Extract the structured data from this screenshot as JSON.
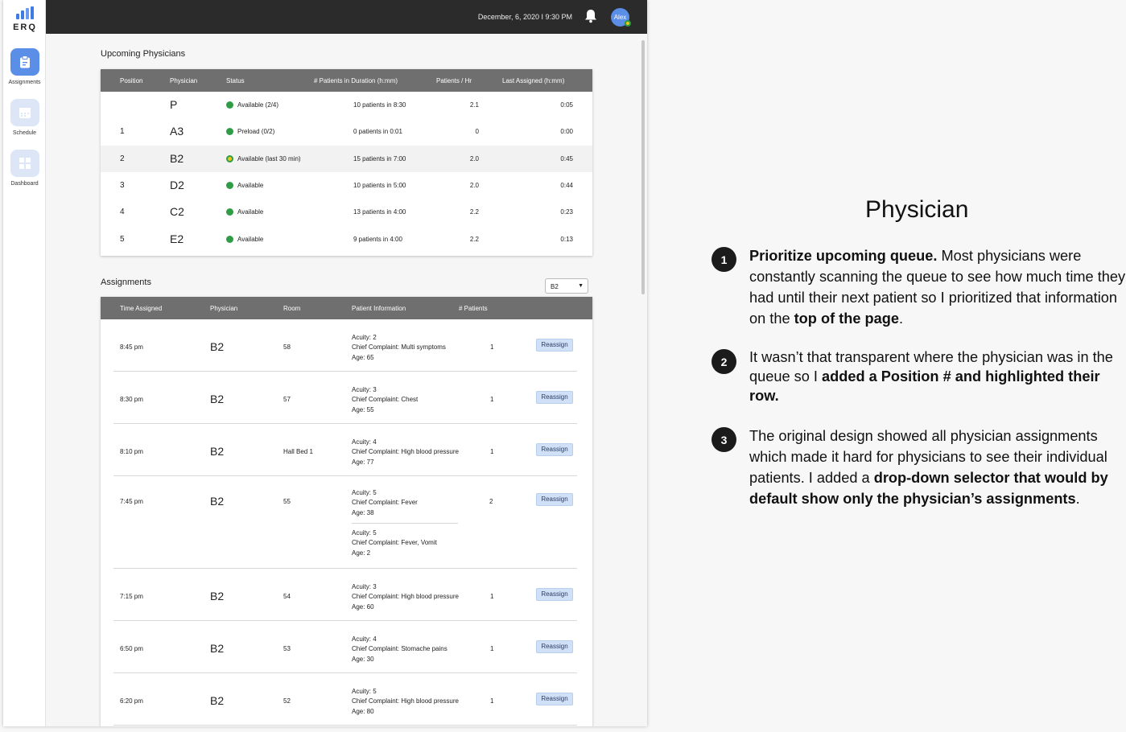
{
  "sidebar": {
    "logo_text": "ERQ",
    "items": [
      {
        "label": "Assignments",
        "active": true
      },
      {
        "label": "Schedule",
        "active": false
      },
      {
        "label": "Dashboard",
        "active": false
      }
    ]
  },
  "topbar": {
    "datetime": "December, 6, 2020  I  9:30 PM",
    "avatar_name": "Alex"
  },
  "upcoming": {
    "title": "Upcoming Physicians",
    "headers": [
      "Position",
      "Physician",
      "Status",
      "# Patients in Duration (h:mm)",
      "Patients / Hr",
      "Last Assigned (h:mm)"
    ],
    "rows": [
      {
        "position": "",
        "physician": "P",
        "status": "Available (2/4)",
        "duration": "10 patients in 8:30",
        "per_hr": "2.1",
        "last": "0:05"
      },
      {
        "position": "1",
        "physician": "A3",
        "status": "Preload (0/2)",
        "duration": "0 patients in 0:01",
        "per_hr": "0",
        "last": "0:00"
      },
      {
        "position": "2",
        "physician": "B2",
        "status": "Available (last 30 min)",
        "duration": "15 patients in 7:00",
        "per_hr": "2.0",
        "last": "0:45"
      },
      {
        "position": "3",
        "physician": "D2",
        "status": "Available",
        "duration": "10 patients in 5:00",
        "per_hr": "2.0",
        "last": "0:44"
      },
      {
        "position": "4",
        "physician": "C2",
        "status": "Available",
        "duration": "13 patients in 4:00",
        "per_hr": "2.2",
        "last": "0:23"
      },
      {
        "position": "5",
        "physician": "E2",
        "status": "Available",
        "duration": "9 patients in 4:00",
        "per_hr": "2.2",
        "last": "0:13"
      }
    ]
  },
  "assignments": {
    "title": "Assignments",
    "filter_value": "B2",
    "headers": [
      "Time Assigned",
      "Physician",
      "Room",
      "Patient Information",
      "# Patients"
    ],
    "action_label": "Reassign",
    "rows": [
      {
        "time": "8:45 pm",
        "physician": "B2",
        "room": "58",
        "acuity": "Acuity: 2",
        "complaint": "Chief Complaint: Multi symptoms",
        "age": "Age: 65",
        "count": "1"
      },
      {
        "time": "8:30 pm",
        "physician": "B2",
        "room": "57",
        "acuity": "Acuity: 3",
        "complaint": "Chief Complaint: Chest",
        "age": "Age: 55",
        "count": "1"
      },
      {
        "time": "8:10 pm",
        "physician": "B2",
        "room": "Hall Bed 1",
        "acuity": "Acuity: 4",
        "complaint": "Chief Complaint: High blood pressure",
        "age": "Age: 77",
        "count": "1"
      },
      {
        "time": "7:45 pm",
        "physician": "B2",
        "room": "55",
        "acuity": "Acuity: 5",
        "complaint": "Chief Complaint: Fever",
        "age": "Age: 38",
        "count": "2",
        "acuity2": "Acuity: 5",
        "complaint2": "Chief Complaint: Fever, Vomit",
        "age2": "Age: 2"
      },
      {
        "time": "7:15 pm",
        "physician": "B2",
        "room": "54",
        "acuity": "Acuity: 3",
        "complaint": "Chief Complaint: High blood pressure",
        "age": "Age: 60",
        "count": "1"
      },
      {
        "time": "6:50 pm",
        "physician": "B2",
        "room": "53",
        "acuity": "Acuity: 4",
        "complaint": "Chief Complaint: Stomache pains",
        "age": "Age: 30",
        "count": "1"
      },
      {
        "time": "6:20 pm",
        "physician": "B2",
        "room": "52",
        "acuity": "Acuity: 5",
        "complaint": "Chief Complaint: High blood pressure",
        "age": "Age: 80",
        "count": "1"
      }
    ]
  },
  "panel": {
    "title": "Physician",
    "notes": [
      {
        "number": "1",
        "parts": [
          {
            "text": "Prioritize upcoming queue.",
            "bold": true
          },
          {
            "text": " Most physicians were constantly scanning the queue to see how much time they had until their next patient so I prioritized that information on the ",
            "bold": false
          },
          {
            "text": "top of the page",
            "bold": true
          },
          {
            "text": ".",
            "bold": false
          }
        ]
      },
      {
        "number": "2",
        "parts": [
          {
            "text": "It wasn’t that transparent where the physician was in the queue so I ",
            "bold": false
          },
          {
            "text": "added a Position # and highlighted their row.",
            "bold": true
          }
        ]
      },
      {
        "number": "3",
        "parts": [
          {
            "text": "The original design showed all physician assignments which made it hard for physicians to see their individual patients. I added a ",
            "bold": false
          },
          {
            "text": "drop-down selector that would by default show only the physician’s assignments",
            "bold": true
          },
          {
            "text": ".",
            "bold": false
          }
        ]
      }
    ]
  },
  "colors": {
    "accent": "#5b8ee6",
    "topbar": "#2b2b2b",
    "table_header": "#6f6f6f",
    "status_green": "#2f9d46",
    "reassign_bg": "#cfe0f7"
  }
}
